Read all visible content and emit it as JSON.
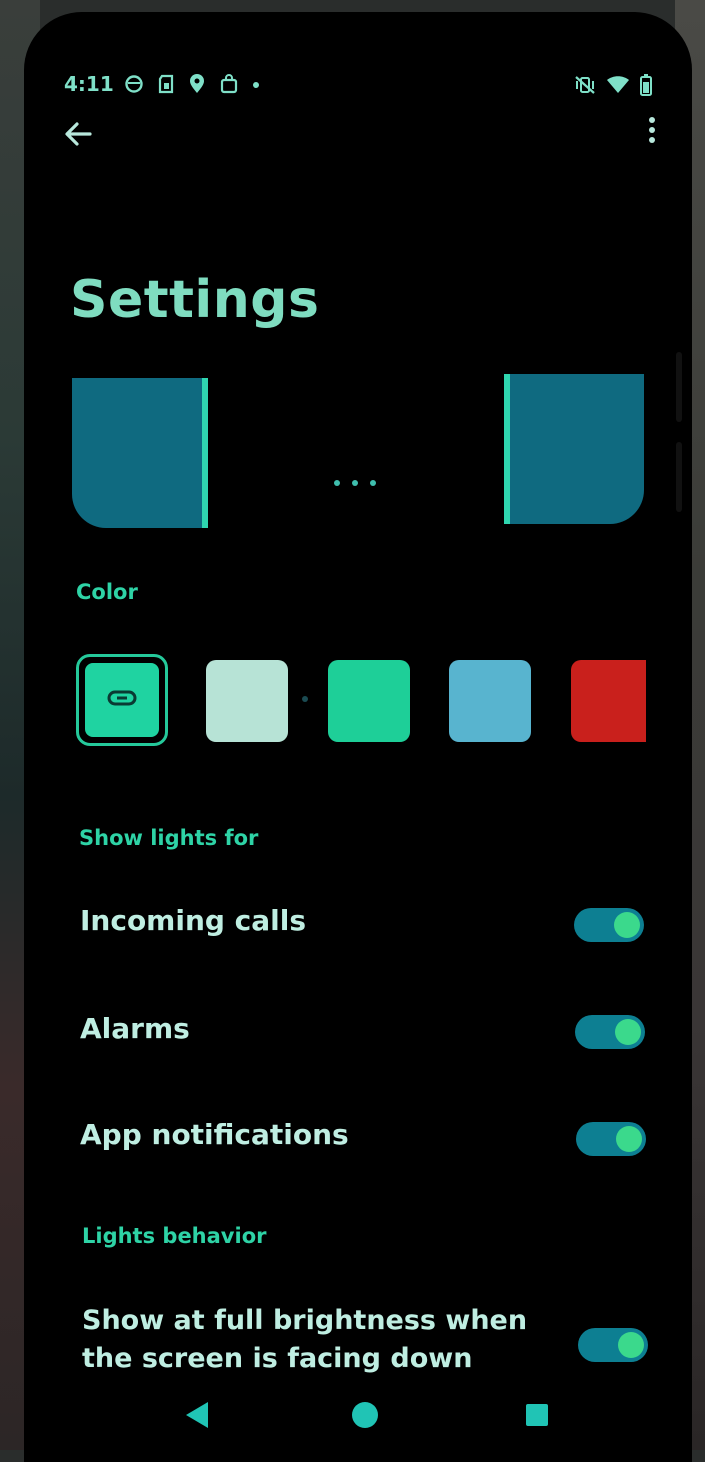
{
  "status_bar": {
    "time": "4:11",
    "left_icons": [
      "circle-app-icon",
      "sim-card-icon",
      "location-pin-icon",
      "shopping-bag-icon",
      "dot-icon"
    ],
    "right_icons": [
      "vibrate-muted-icon",
      "wifi-icon",
      "battery-icon"
    ]
  },
  "toolbar": {
    "back_icon": "arrow-left-icon",
    "menu_icon": "more-vert-icon"
  },
  "page": {
    "title": "Settings"
  },
  "sections": {
    "color_label": "Color",
    "show_lights_label": "Show lights for",
    "behavior_label": "Lights behavior"
  },
  "color_swatches": [
    {
      "name": "linked",
      "color": "#1fd3a1",
      "selected": true,
      "icon": "link-icon"
    },
    {
      "name": "mint",
      "color": "#b7e3d6",
      "selected": false
    },
    {
      "name": "green",
      "color": "#1ecf98",
      "selected": false
    },
    {
      "name": "blue",
      "color": "#58b4cf",
      "selected": false
    },
    {
      "name": "red",
      "color": "#c9201c",
      "selected": false
    }
  ],
  "settings": [
    {
      "label": "Incoming calls",
      "enabled": true
    },
    {
      "label": "Alarms",
      "enabled": true
    },
    {
      "label": "App notifications",
      "enabled": true
    }
  ],
  "behavior": {
    "label": "Show at full brightness when the screen is facing down",
    "enabled": true
  },
  "nav": {
    "back_icon": "triangle-back-icon",
    "home_icon": "circle-home-icon",
    "recents_icon": "square-recents-icon"
  },
  "colors": {
    "accent": "#2ed3a6",
    "toggle_track": "#0d7f92",
    "toggle_knob": "#3bd98c",
    "title": "#7fdcc0",
    "label": "#bfeee2",
    "preview_panel": "#0f6a80"
  }
}
